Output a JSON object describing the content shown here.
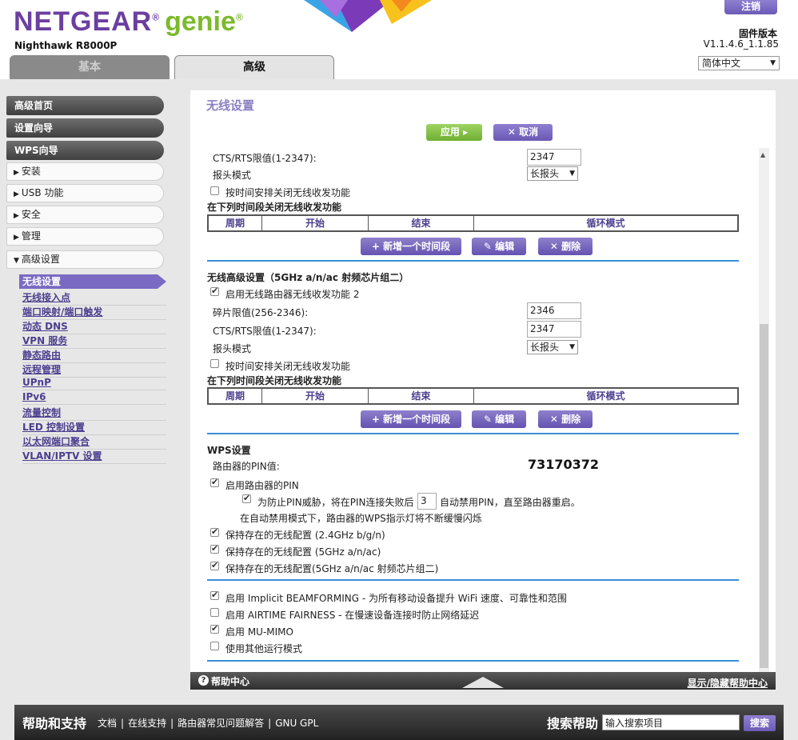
{
  "header": {
    "brand": "NETGEAR",
    "brand_sub": "genie",
    "model": "Nighthawk R8000P",
    "logout_label": "注销",
    "firmware_label": "固件版本",
    "firmware_version": "V1.1.4.6_1.1.85",
    "language": "简体中文",
    "tab_basic": "基本",
    "tab_advanced": "高级"
  },
  "sidebar": {
    "main_items": [
      "高级首页",
      "设置向导",
      "WPS向导"
    ],
    "sub_items": [
      "安装",
      "USB 功能",
      "安全",
      "管理",
      "高级设置"
    ],
    "links": [
      "无线设置",
      "无线接入点",
      "端口映射/端口触发",
      "动态 DNS",
      "VPN 服务",
      "静态路由",
      "远程管理",
      "UPnP",
      "IPv6",
      "流量控制",
      "LED 控制设置",
      "以太网端口聚合",
      "VLAN/IPTV 设置"
    ]
  },
  "page": {
    "title": "无线设置",
    "apply_label": "应用 ▸",
    "cancel_label": "✕ 取消"
  },
  "section1": {
    "cts_label": "CTS/RTS限值(1-2347):",
    "cts_value": "2347",
    "preamble_label": "报头模式",
    "preamble_value": "长报头",
    "schedule_label": "按时间安排关闭无线收发功能",
    "period_title": "在下列时间段关闭无线收发功能",
    "table_headers": [
      "周期",
      "开始",
      "结束",
      "循环模式"
    ],
    "add_label": "+ 新增一个时间段",
    "edit_label": "✎ 编辑",
    "delete_label": "✕ 删除"
  },
  "section2": {
    "title": "无线高级设置（5GHz a/n/ac 射频芯片组二）",
    "enable_label": "启用无线路由器无线收发功能 2",
    "frag_label": "碎片限值(256-2346):",
    "frag_value": "2346",
    "cts_label": "CTS/RTS限值(1-2347):",
    "cts_value": "2347",
    "preamble_label": "报头模式",
    "preamble_value": "长报头",
    "schedule_label": "按时间安排关闭无线收发功能",
    "period_title": "在下列时间段关闭无线收发功能",
    "table_headers": [
      "周期",
      "开始",
      "结束",
      "循环模式"
    ],
    "add_label": "+ 新增一个时间段",
    "edit_label": "✎ 编辑",
    "delete_label": "✕ 删除"
  },
  "wps": {
    "title": "WPS设置",
    "pin_label": "路由器的PIN值:",
    "pin_value": "73170372",
    "enable_pin_label": "启用路由器的PIN",
    "lock_prefix": "为防止PIN威胁，将在PIN连接失败后",
    "lock_value": "3",
    "lock_suffix": "自动禁用PIN，直至路由器重启。",
    "lock_note": "在自动禁用模式下，路由器的WPS指示灯将不断缓慢闪烁",
    "keep_24": "保持存在的无线配置 (2.4GHz b/g/n)",
    "keep_5": "保持存在的无线配置 (5GHz a/n/ac)",
    "keep_5b": "保持存在的无线配置(5GHz a/n/ac 射频芯片组二)"
  },
  "advanced": {
    "beamforming": "启用 Implicit BEAMFORMING - 为所有移动设备提升 WiFi 速度、可靠性和范围",
    "airtime": "启用 AIRTIME FAIRNESS - 在慢速设备连接时防止网络延迟",
    "mumimo": "启用 MU-MIMO",
    "other_mode": "使用其他运行模式"
  },
  "helpbar": {
    "label": "帮助中心",
    "toggle": "显示/隐藏帮助中心"
  },
  "footer": {
    "title": "帮助和支持",
    "links": [
      "文档",
      "在线支持",
      "路由器常见问题解答",
      "GNU GPL"
    ],
    "search_label": "搜索帮助",
    "search_value": "输入搜索项目",
    "search_button": "搜索"
  },
  "colors": {
    "accent_purple": "#6b3fa0",
    "accent_green": "#7cba2c",
    "link_purple": "#4b3f8e",
    "divider_blue": "#3a8ed8"
  }
}
